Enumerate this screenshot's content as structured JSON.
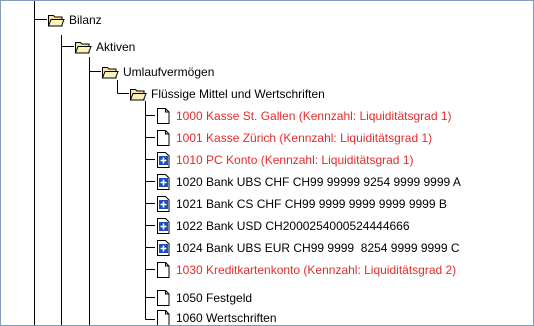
{
  "colors": {
    "normal_text": "#000000",
    "highlight_text": "#e52b2b",
    "folder_fill": "#f6e49b",
    "tree_line": "#000000",
    "plus_fill": "#1a4fb5"
  },
  "tree": {
    "nodes": [
      {
        "label": "Bilanz",
        "icon": "folder-open-icon",
        "red": false
      },
      {
        "label": "Aktiven",
        "icon": "folder-open-icon",
        "red": false
      },
      {
        "label": "Umlaufvermögen",
        "icon": "folder-open-icon",
        "red": false
      },
      {
        "label": "Flüssige Mittel und Wertschriften",
        "icon": "folder-open-icon",
        "red": false
      },
      {
        "label": "1000 Kasse St. Gallen (Kennzahl: Liquiditätsgrad 1)",
        "icon": "document-icon",
        "red": true
      },
      {
        "label": "1001 Kasse Zürich (Kennzahl: Liquiditätsgrad 1)",
        "icon": "document-icon",
        "red": true
      },
      {
        "label": "1010 PC Konto (Kennzahl: Liquiditätsgrad 1)",
        "icon": "document-plus-icon",
        "red": true
      },
      {
        "label": "1020 Bank UBS CHF CH99 99999 9254 9999 9999 A",
        "icon": "document-plus-icon",
        "red": false
      },
      {
        "label": "1021 Bank CS CHF CH99 9999 9999 9999 9999 B",
        "icon": "document-plus-icon",
        "red": false
      },
      {
        "label": "1022 Bank USD CH2000254000524444666",
        "icon": "document-plus-icon",
        "red": false
      },
      {
        "label": "1024 Bank UBS EUR CH99 9999  8254 9999 9999 C",
        "icon": "document-plus-icon",
        "red": false
      },
      {
        "label": "1030 Kreditkartenkonto (Kennzahl: Liquiditätsgrad 2)",
        "icon": "document-icon",
        "red": true
      },
      {
        "label": "1050 Festgeld",
        "icon": "document-icon",
        "red": false
      },
      {
        "label": "1060 Wertschriften",
        "icon": "document-icon",
        "red": false
      }
    ]
  }
}
